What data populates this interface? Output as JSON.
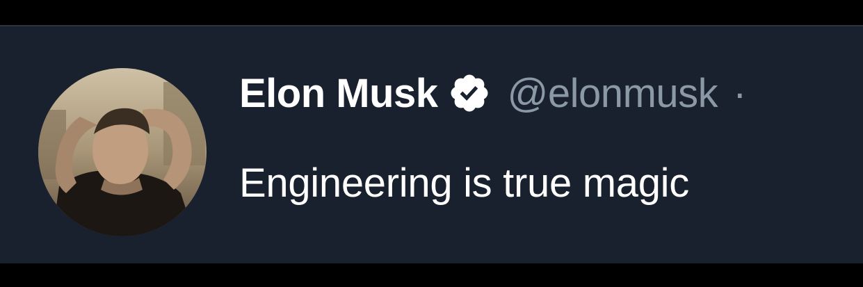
{
  "tweet": {
    "author": {
      "display_name": "Elon Musk",
      "handle": "@elonmusk",
      "verified": true,
      "avatar_icon": "profile-photo"
    },
    "separator": "·",
    "text": "Engineering is true magic"
  },
  "colors": {
    "background": "#1a212e",
    "name": "#ffffff",
    "handle": "#8b98a5",
    "text": "#ffffff",
    "verified_badge": "#ffffff"
  }
}
